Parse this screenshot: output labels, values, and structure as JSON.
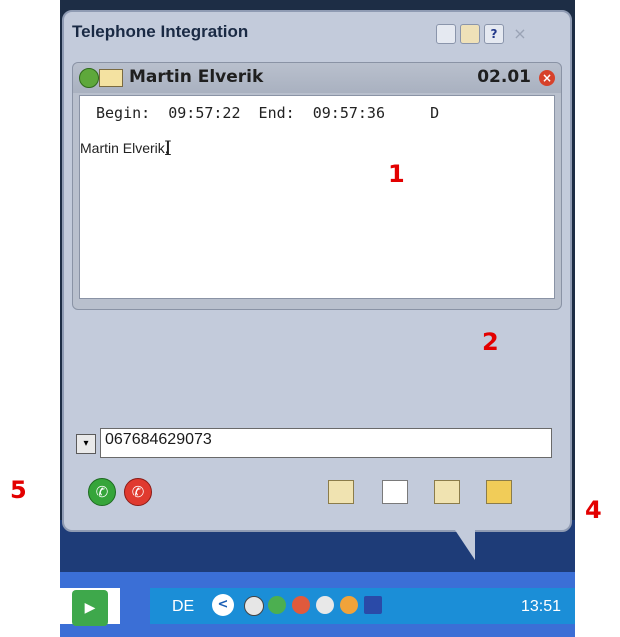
{
  "window": {
    "title": "Telephone Integration",
    "help_glyph": "?",
    "close_glyph": "×"
  },
  "call": {
    "contact_name": "Martin Elverik",
    "date": "02.01",
    "close_glyph": "×",
    "times_line": "Begin:  09:57:22  End:  09:57:36     D",
    "notes_text": "Martin Elverik,"
  },
  "dial": {
    "phone_number": "067684629073",
    "dropdown_glyph": "▾"
  },
  "actions": {
    "accept_glyph": "✆",
    "reject_glyph": "✆"
  },
  "taskbar": {
    "start_glyph": "▶",
    "language": "DE",
    "back_glyph": "<",
    "clock": "13:51"
  },
  "markers": [
    "1",
    "2",
    "4",
    "5"
  ],
  "colors": {
    "window_bg": "#c3cbdb",
    "marker_red": "#e30000",
    "accept_green": "#36a53a",
    "reject_red": "#e03a2f",
    "taskbar_blue": "#3b6fd6"
  }
}
